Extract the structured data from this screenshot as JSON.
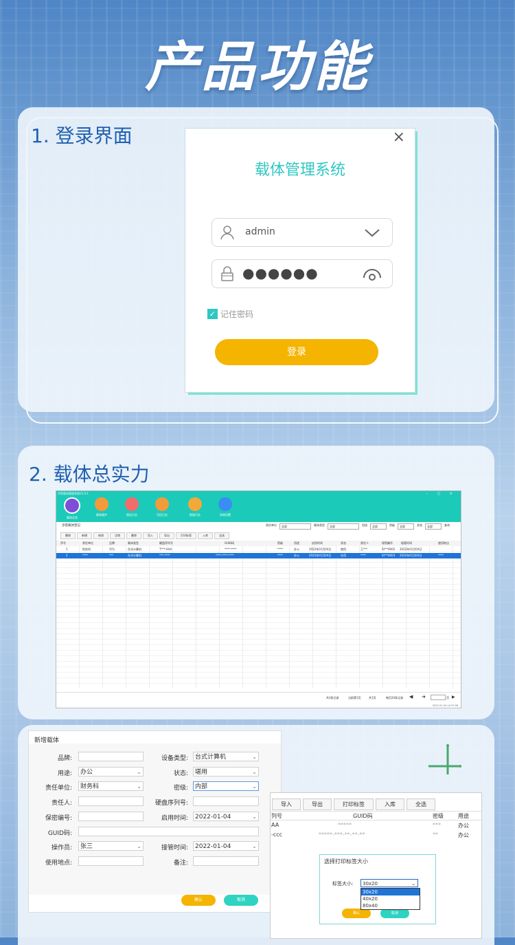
{
  "hero_title": "产品功能",
  "section1": {
    "title": "1. 登录界面",
    "login": {
      "close": "×",
      "system_title": "载体管理系统",
      "username": "admin",
      "password_mask": "●●●●●●",
      "remember_label": "记住密码",
      "remember_checked": true,
      "login_button": "登录",
      "accent": "#2fc7c2",
      "button_color": "#f4b400"
    }
  },
  "section2": {
    "title": "2. 载体总实力",
    "app": {
      "window_title": "涉密载体管理系统V1.0.1",
      "window_controls": "– □ ×",
      "ribbon": [
        {
          "label": "载体总览",
          "color": "#7d4fd6"
        },
        {
          "label": "载体维护",
          "color": "#f29b3a"
        },
        {
          "label": "借出日志",
          "color": "#f26b6b"
        },
        {
          "label": "归还日志",
          "color": "#f29b3a"
        },
        {
          "label": "损毁日志",
          "color": "#f2a93a"
        },
        {
          "label": "系统设置",
          "color": "#3a8df2"
        }
      ],
      "crumb": "涉密载体登记",
      "filters": [
        {
          "label": "责任单位",
          "value": "全部"
        },
        {
          "label": "载体类型",
          "value": "全部"
        },
        {
          "label": "用途",
          "value": "全部"
        },
        {
          "label": "密级",
          "value": "全部"
        },
        {
          "label": "状态",
          "value": "全部"
        }
      ],
      "search": "查询",
      "toolbar": [
        "删除",
        "新增",
        "修改",
        "注销",
        "删除",
        "导入",
        "导出",
        "打印标签",
        "入库",
        "全选"
      ],
      "columns": [
        "序号",
        "责任单位",
        "品牌",
        "载体类型",
        "硬盘序列号",
        "GUID码",
        "密级",
        "用途",
        "启用时间",
        "状态",
        "责任人",
        "保密编号",
        "接管时间",
        "使用地点"
      ],
      "rows": [
        [
          "1",
          "财务科",
          "华为",
          "台式计算机",
          "T***-AAA",
          "****-****",
          "****",
          "办公",
          "2022年01月04日",
          "使用",
          "王***",
          "SY**0002",
          "2022年01月04日",
          ""
        ],
        [
          "2",
          "****",
          "***",
          "台式计算机",
          "***-****",
          "****-****-****",
          "****",
          "办公",
          "2022年01月04日",
          "在用",
          "****",
          "SY**0003",
          "2022年01月04日",
          "****"
        ]
      ],
      "status_items": [
        "共3条记录",
        "当前第1页",
        "共1页",
        "每页20条记录"
      ],
      "pager": "页",
      "footer_time": "2022-01-04 14:37:06"
    }
  },
  "dialog": {
    "title": "新增载体",
    "fields_left": [
      {
        "label": "品牌:",
        "value": ""
      },
      {
        "label": "用途:",
        "value": "办公",
        "dropdown": true
      },
      {
        "label": "责任单位:",
        "value": "财务科",
        "dropdown": true
      },
      {
        "label": "责任人:",
        "value": ""
      },
      {
        "label": "保密编号:",
        "value": ""
      },
      {
        "label": "GUID码:",
        "value": ""
      },
      {
        "label": "操作员:",
        "value": "张三",
        "dropdown": true
      },
      {
        "label": "使用地点:",
        "value": ""
      }
    ],
    "fields_right": [
      {
        "label": "设备类型:",
        "value": "台式计算机",
        "dropdown": true
      },
      {
        "label": "状态:",
        "value": "堪用",
        "dropdown": true
      },
      {
        "label": "密级:",
        "value": "内部",
        "dropdown": true
      },
      {
        "label": "硬盘序列号:",
        "value": ""
      },
      {
        "label": "启用时间:",
        "value": "2022-01-04",
        "dropdown": true
      },
      {
        "label": "接管时间:",
        "value": "2022-01-04",
        "dropdown": true
      },
      {
        "label": "备注:",
        "value": ""
      }
    ],
    "confirm": "确认",
    "cancel": "取消"
  },
  "print_panel": {
    "toolbar": [
      "导入",
      "导出",
      "打印标签",
      "入库",
      "全选"
    ],
    "columns": [
      "列号",
      "GUID码",
      "密级",
      "用途"
    ],
    "rows": [
      [
        "AA",
        "*****",
        "***",
        "办公"
      ],
      [
        "-ccc",
        "*****-***-**-**-**",
        "**",
        "办公"
      ]
    ],
    "size_dialog": {
      "title": "选择打印标签大小",
      "label": "标签大小:",
      "selected": "30x20",
      "options": [
        "30x20",
        "40x20",
        "80x40"
      ],
      "confirm": "确认",
      "cancel": "取消"
    }
  }
}
